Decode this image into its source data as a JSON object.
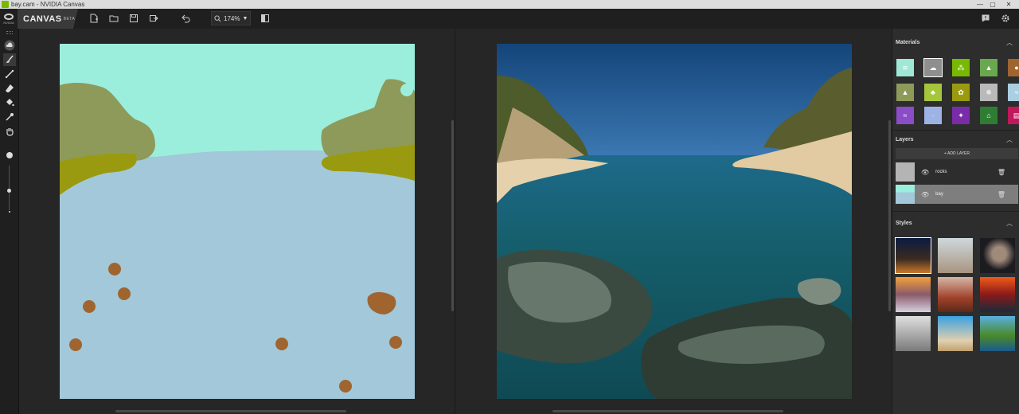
{
  "window": {
    "title": "bay.cam - NVIDIA Canvas",
    "controls": [
      "—",
      "▢",
      "✕"
    ]
  },
  "toolbar": {
    "logo_text": "NVIDIA",
    "brand": "CANVAS",
    "brand_badge": "BETA",
    "zoom": "174%",
    "icons": [
      "new-file-icon",
      "open-folder-icon",
      "save-icon",
      "export-icon",
      "undo-icon",
      "zoom-icon",
      "split-view-icon",
      "feedback-icon",
      "settings-icon"
    ]
  },
  "tools": [
    "materials-cloud-icon",
    "brush-icon",
    "line-icon",
    "eraser-icon",
    "fill-bucket-icon",
    "eyedropper-icon",
    "hand-icon"
  ],
  "sidebar": {
    "materials_title": "Materials",
    "materials": [
      {
        "name": "sky",
        "color": "#9fe8d5",
        "glyph": "≋"
      },
      {
        "name": "cloud",
        "color": "#8e8e8e",
        "glyph": "☁"
      },
      {
        "name": "grass",
        "color": "#76b900",
        "glyph": "⁂"
      },
      {
        "name": "hill",
        "color": "#6aa84f",
        "glyph": "▲"
      },
      {
        "name": "rock",
        "color": "#a0652f",
        "glyph": "●"
      },
      {
        "name": "mountain",
        "color": "#8e9a5a",
        "glyph": "▲"
      },
      {
        "name": "tree",
        "color": "#a5c63b",
        "glyph": "♣"
      },
      {
        "name": "bush",
        "color": "#9a9a10",
        "glyph": "✿"
      },
      {
        "name": "snow",
        "color": "#b9b9b9",
        "glyph": "❄"
      },
      {
        "name": "water",
        "color": "#a9cfe0",
        "glyph": "≈"
      },
      {
        "name": "river",
        "color": "#8a4cc7",
        "glyph": "≈"
      },
      {
        "name": "fog",
        "color": "#9db3e6",
        "glyph": "∙"
      },
      {
        "name": "sparkle",
        "color": "#7a2ca8",
        "glyph": "✦"
      },
      {
        "name": "building",
        "color": "#2e7d32",
        "glyph": "⌂"
      },
      {
        "name": "sand",
        "color": "#c2185b",
        "glyph": "▤"
      }
    ],
    "layers_title": "Layers",
    "add_layer": "+ ADD LAYER",
    "layers": [
      {
        "name": "rocks",
        "selected": false
      },
      {
        "name": "bay",
        "selected": true
      }
    ],
    "styles_title": "Styles",
    "styles": [
      "style-1",
      "style-2",
      "style-3",
      "style-4",
      "style-5",
      "style-6",
      "style-7",
      "style-8",
      "style-9"
    ]
  }
}
